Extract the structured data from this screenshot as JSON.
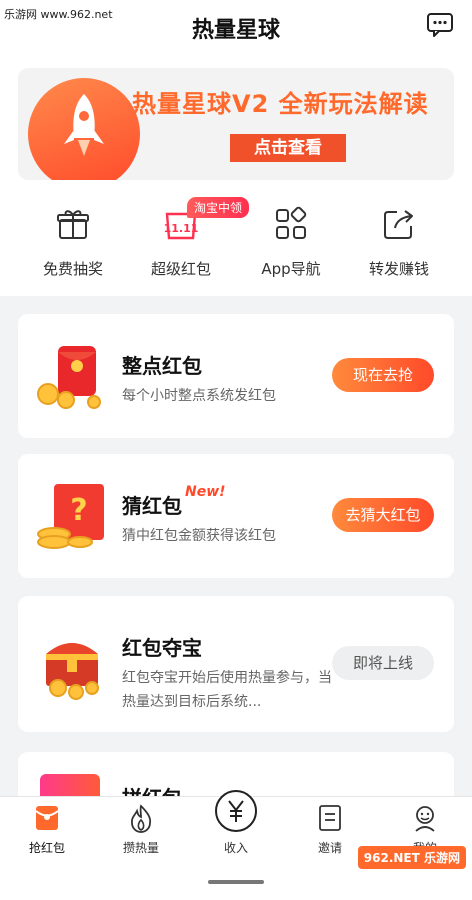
{
  "watermark": {
    "top_text": "乐游网 www.962.net",
    "bottom_text": "962.NET 乐游网"
  },
  "header": {
    "title": "热量星球",
    "message_icon": "message-dots-icon"
  },
  "banner": {
    "title": "热量星球V2  全新玩法解读",
    "button_label": "点击查看"
  },
  "quick_actions": [
    {
      "label": "免费抽奖",
      "icon": "gift-icon"
    },
    {
      "label": "超级红包",
      "icon": "double11-icon",
      "badge": "淘宝中领"
    },
    {
      "label": "App导航",
      "icon": "apps-grid-icon"
    },
    {
      "label": "转发赚钱",
      "icon": "share-icon"
    }
  ],
  "cards": [
    {
      "title": "整点红包",
      "desc": "每个小时整点系统发红包",
      "button": "现在去抢",
      "state": "active"
    },
    {
      "title": "猜红包",
      "tag": "New!",
      "desc": "猜中红包金额获得该红包",
      "button": "去猜大红包",
      "state": "active"
    },
    {
      "title": "红包夺宝",
      "desc": "红包夺宝开始后使用热量参与，当热量达到目标后系统...",
      "button": "即将上线",
      "state": "disabled"
    },
    {
      "title": "拼红包"
    }
  ],
  "tabbar": [
    {
      "label": "抢红包",
      "icon": "red-envelope-icon",
      "active": true
    },
    {
      "label": "攒热量",
      "icon": "flame-icon",
      "active": false
    },
    {
      "label": "收入",
      "icon": "yuan-circle-icon",
      "active": false
    },
    {
      "label": "邀请",
      "icon": "invite-doc-icon",
      "active": false
    },
    {
      "label": "我的",
      "icon": "profile-icon",
      "active": false
    }
  ],
  "colors": {
    "accent": "#ff4a2a",
    "accent_light": "#ff8a3c",
    "background": "#f2f3f5"
  }
}
